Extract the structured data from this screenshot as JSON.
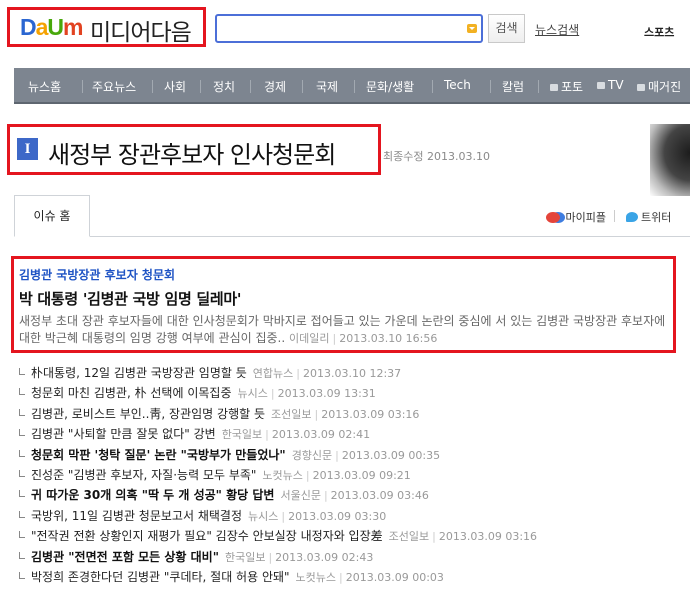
{
  "header": {
    "logo_parts": [
      "D",
      "a",
      "U",
      "m"
    ],
    "logo_media": "미디어다음",
    "search_placeholder": "",
    "search_button": "검색",
    "news_search": "뉴스검색",
    "sports": "스포츠"
  },
  "nav": {
    "items": [
      "뉴스홈",
      "주요뉴스",
      "사회",
      "정치",
      "경제",
      "국제",
      "문화/생활",
      "Tech",
      "칼럼",
      "포토",
      "TV",
      "매거진"
    ]
  },
  "issue": {
    "title": "새정부 장관후보자 인사청문회",
    "title_icon": "I",
    "updated": "최종수정 2013.03.10"
  },
  "tabs": {
    "active": "이슈 홈",
    "mypeople": "마이피플",
    "twitter": "트위터"
  },
  "featured": {
    "category": "김병관 국방장관 후보자 청문회",
    "headline": "박 대통령 '김병관 국방 임명 딜레마'",
    "summary": "새정부 초대 장관 후보자들에 대한 인사청문회가 막바지로 접어들고 있는 가운데 논란의 중심에 서 있는 김병관 국방장관 후보자에 대한 박근혜 대통령의 임명 강행 여부에 관심이 집중..",
    "source": "이데일리",
    "date": "2013.03.10 16:56"
  },
  "articles": [
    {
      "title": "朴대통령, 12일 김병관 국방장관 임명할 듯",
      "source": "연합뉴스",
      "date": "2013.03.10 12:37",
      "bold": false
    },
    {
      "title": "청문회 마친 김병관, 朴 선택에 이목집중",
      "source": "뉴시스",
      "date": "2013.03.09 13:31",
      "bold": false
    },
    {
      "title": "김병관, 로비스트 부인..靑, 장관임명 강행할 듯",
      "source": "조선일보",
      "date": "2013.03.09 03:16",
      "bold": false
    },
    {
      "title": "김병관 \"사퇴할 만큼 잘못 없다\" 강변",
      "source": "한국일보",
      "date": "2013.03.09 02:41",
      "bold": false
    },
    {
      "title": "청문회 막판 '청탁 질문' 논란 \"국방부가 만들었나\"",
      "source": "경향신문",
      "date": "2013.03.09 00:35",
      "bold": true
    },
    {
      "title": "진성준 \"김병관 후보자, 자질·능력 모두 부족\"",
      "source": "노컷뉴스",
      "date": "2013.03.09 09:21",
      "bold": false
    },
    {
      "title": "귀 따가운 30개 의혹 \"딱 두 개 성공\" 황당 답변",
      "source": "서울신문",
      "date": "2013.03.09 03:46",
      "bold": true
    },
    {
      "title": "국방위, 11일 김병관 청문보고서 채택결정",
      "source": "뉴시스",
      "date": "2013.03.09 03:30",
      "bold": false
    },
    {
      "title": "\"전작권 전환 상황인지 재평가 필요\" 김장수 안보실장 내정자와 입장差",
      "source": "조선일보",
      "date": "2013.03.09 03:16",
      "bold": false
    },
    {
      "title": "김병관 \"전면전 포함 모든 상황 대비\"",
      "source": "한국일보",
      "date": "2013.03.09 02:43",
      "bold": true
    },
    {
      "title": "박정희 존경한다던 김병관 \"쿠데타, 절대 허용 안돼\"",
      "source": "노컷뉴스",
      "date": "2013.03.09 00:03",
      "bold": false
    }
  ],
  "colors": {
    "highlight_border": "#e4151f",
    "nav_bg": "#7d8590",
    "category_blue": "#1e53c4",
    "search_border": "#4c6fd8"
  }
}
